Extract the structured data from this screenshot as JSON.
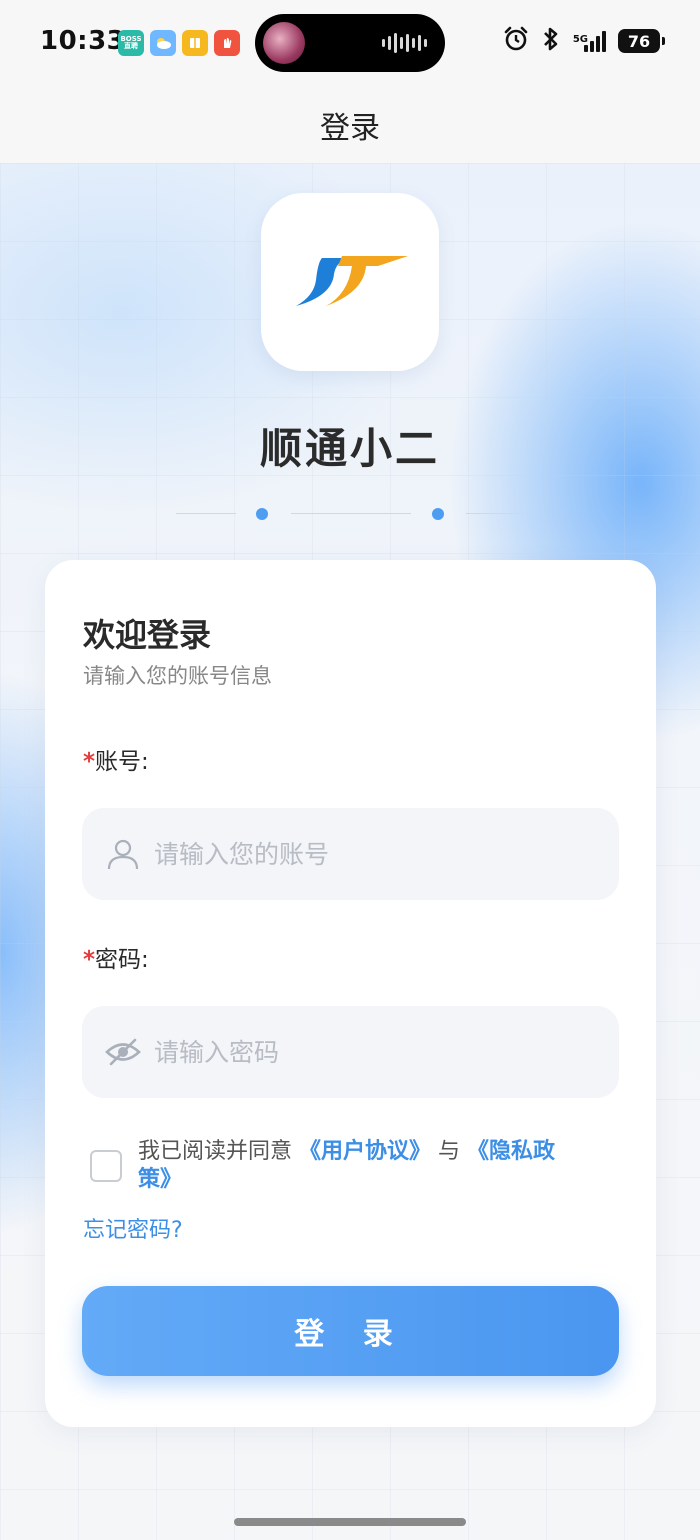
{
  "status_bar": {
    "time": "10:33",
    "boss_icon_text": "BOSS直聘",
    "battery": "76",
    "network": "5G"
  },
  "navbar": {
    "title": "登录"
  },
  "brand": {
    "name": "顺通小二",
    "accent_orange": "#f3a51d",
    "accent_blue": "#1e7fd8"
  },
  "login_card": {
    "title": "欢迎登录",
    "subtitle": "请输入您的账号信息",
    "required_mark": "*",
    "account_label": "账号:",
    "account_placeholder": "请输入您的账号",
    "password_label": "密码:",
    "password_placeholder": "请输入密码",
    "agreement_prefix": "我已阅读并同意",
    "user_agreement": "《用户协议》",
    "agreement_join": "与",
    "privacy_policy": "《隐私政策》",
    "forgot_password": "忘记密码?",
    "login_button": "登 录",
    "link_color": "#3d8fe6",
    "button_color": "#4a96f0"
  }
}
